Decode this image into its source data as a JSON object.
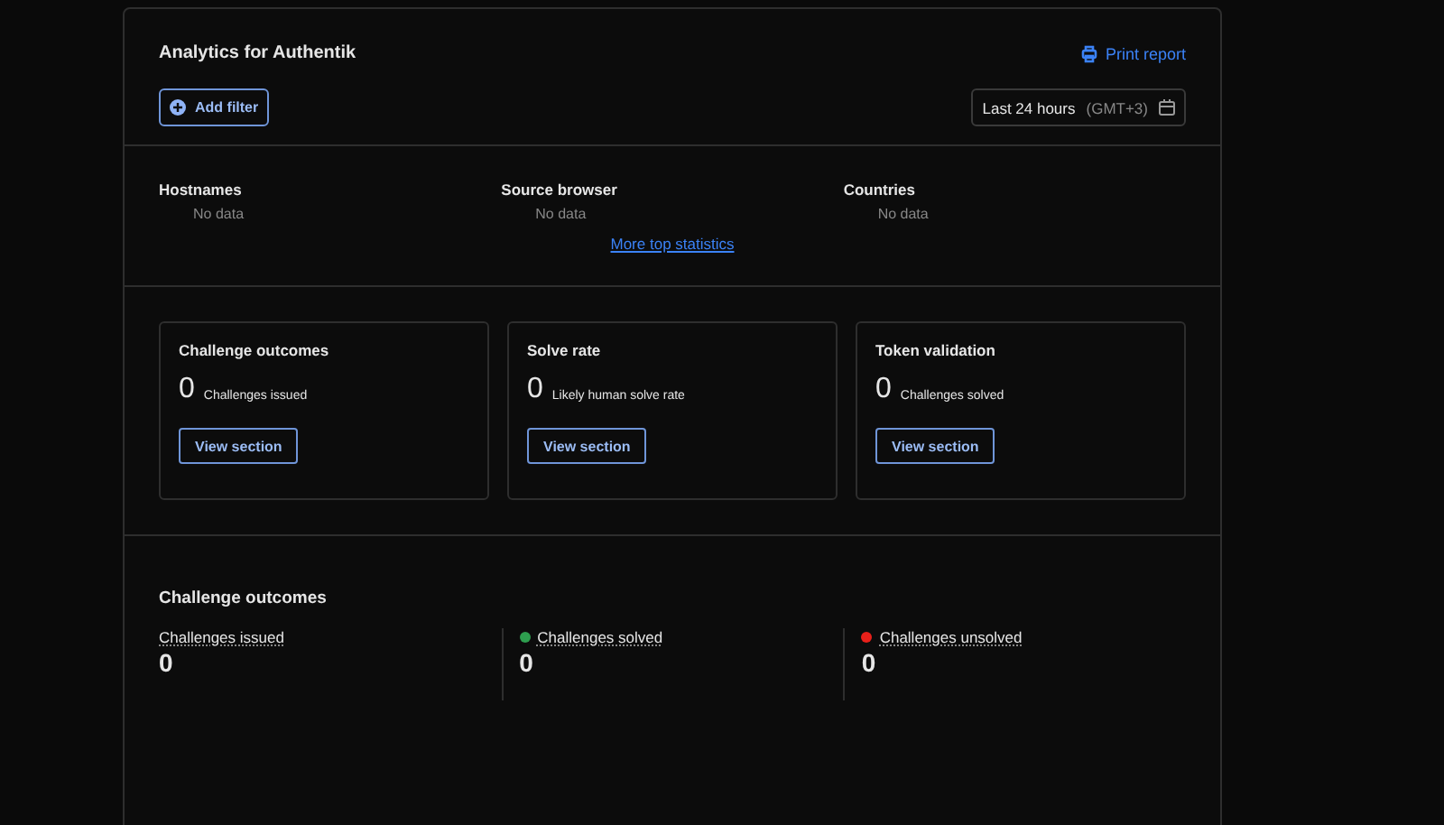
{
  "header": {
    "title": "Analytics for Authentik",
    "print_link": "Print report",
    "add_filter": "Add filter",
    "time_range": {
      "label": "Last 24 hours",
      "timezone": "(GMT+3)"
    }
  },
  "top_statistics": {
    "columns": [
      {
        "title": "Hostnames",
        "value": "No data"
      },
      {
        "title": "Source browser",
        "value": "No data"
      },
      {
        "title": "Countries",
        "value": "No data"
      }
    ],
    "more_link": "More top statistics"
  },
  "cards": [
    {
      "title": "Challenge outcomes",
      "value": "0",
      "caption": "Challenges issued",
      "button": "View section"
    },
    {
      "title": "Solve rate",
      "value": "0",
      "caption": "Likely human solve rate",
      "button": "View section"
    },
    {
      "title": "Token validation",
      "value": "0",
      "caption": "Challenges solved",
      "button": "View section"
    }
  ],
  "outcomes": {
    "title": "Challenge outcomes",
    "items": [
      {
        "label": "Challenges issued",
        "value": "0"
      },
      {
        "label": "Challenges solved",
        "value": "0",
        "color": "#2e9e4f"
      },
      {
        "label": "Challenges unsolved",
        "value": "0",
        "color": "#e8201a"
      }
    ]
  }
}
